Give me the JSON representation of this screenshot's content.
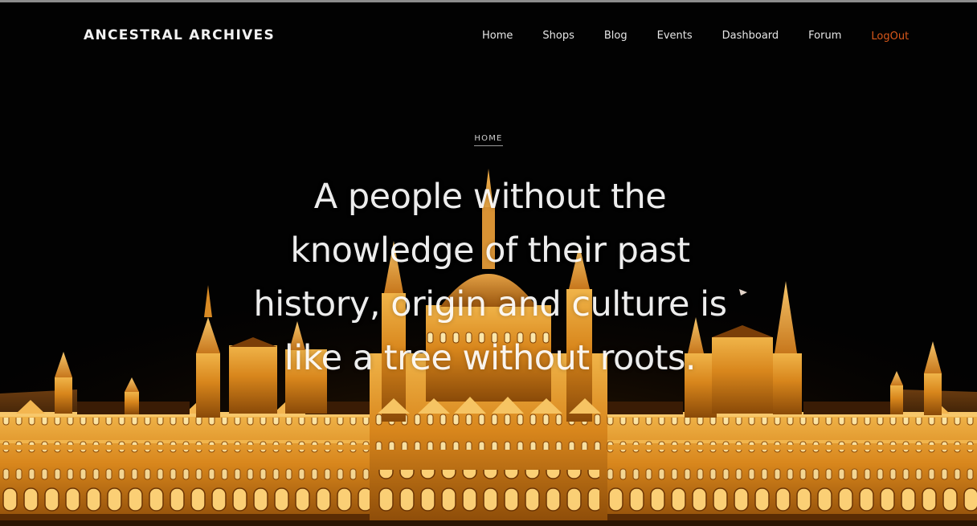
{
  "header": {
    "brand": "ANCESTRAL ARCHIVES",
    "nav": [
      {
        "label": "Home"
      },
      {
        "label": "Shops"
      },
      {
        "label": "Blog"
      },
      {
        "label": "Events"
      },
      {
        "label": "Dashboard"
      },
      {
        "label": "Forum"
      },
      {
        "label": "LogOut"
      }
    ]
  },
  "hero": {
    "breadcrumb": "HOME",
    "quote_lines": [
      "A people without the",
      "knowledge of their past",
      "history, origin and culture is",
      "like a tree without roots."
    ]
  },
  "colors": {
    "background": "#030303",
    "logout_accent": "#d9581a",
    "building_glow": "#f2a93b"
  }
}
